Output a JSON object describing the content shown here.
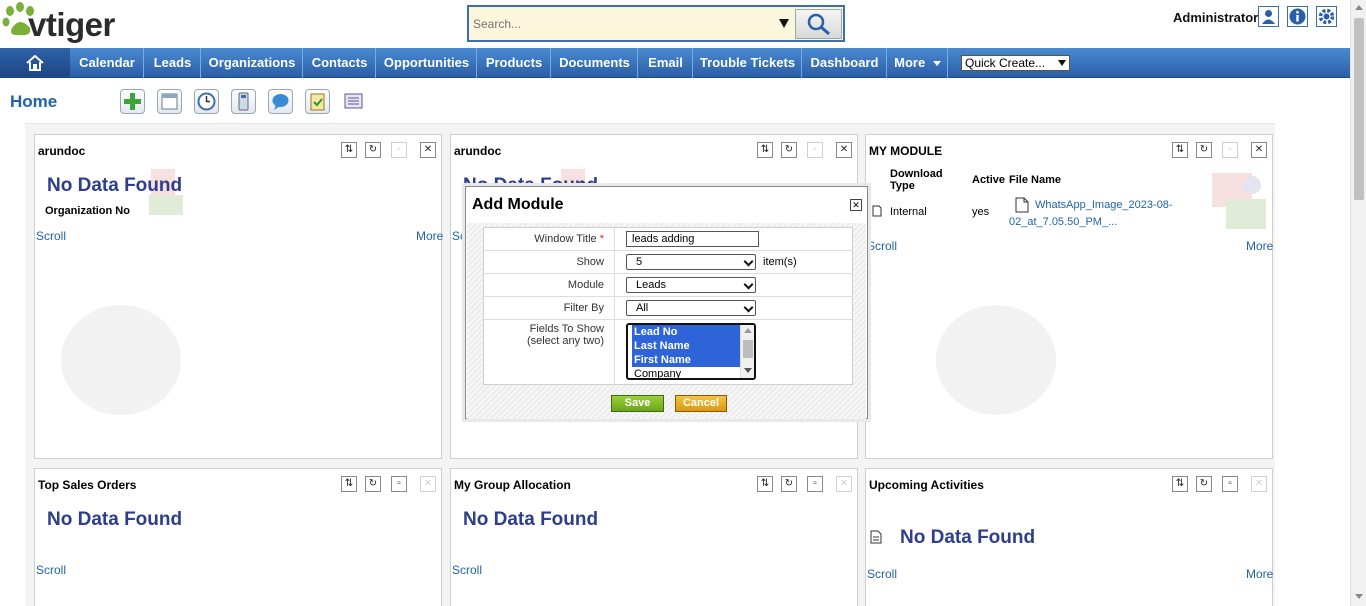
{
  "app": {
    "logo_text": "vtiger",
    "user": "Administrator"
  },
  "search": {
    "placeholder": "Search..."
  },
  "nav": {
    "items": [
      "Calendar",
      "Leads",
      "Organizations",
      "Contacts",
      "Opportunities",
      "Products",
      "Documents",
      "Email",
      "Trouble Tickets",
      "Dashboard",
      "More"
    ],
    "quick_create": "Quick Create..."
  },
  "page": {
    "title": "Home"
  },
  "widgets": {
    "w1": {
      "title": "arundoc",
      "nodata": "No Data Found",
      "column": "Organization No",
      "scroll": "Scroll",
      "more": "More"
    },
    "w2": {
      "title": "arundoc",
      "nodata": "No Data Found",
      "scroll": "Scroll"
    },
    "w3": {
      "title": "MY MODULE",
      "col_download_type": "Download Type",
      "col_active": "Active",
      "col_file_name": "File Name",
      "row_type": "Internal",
      "row_active": "yes",
      "row_file_line1": "WhatsApp_Image_2023-08-",
      "row_file_line2": "02_at_7.05.50_PM_...",
      "scroll": "Scroll",
      "more": "More"
    },
    "w4": {
      "title": "Top Sales Orders",
      "nodata": "No Data Found",
      "scroll": "Scroll"
    },
    "w5": {
      "title": "My Group Allocation",
      "nodata": "No Data Found",
      "scroll": "Scroll"
    },
    "w6": {
      "title": "Upcoming Activities",
      "nodata": "No Data Found",
      "scroll": "Scroll",
      "more": "More"
    }
  },
  "modal": {
    "title": "Add Module",
    "window_title_label": "Window Title",
    "required_mark": "*",
    "window_title_value": "leads adding",
    "show_label": "Show",
    "show_value": "5",
    "show_suffix": "item(s)",
    "module_label": "Module",
    "module_value": "Leads",
    "filter_label": "Filter By",
    "filter_value": "All",
    "fields_label_1": "Fields To Show",
    "fields_label_2": "(select any two)",
    "fields": [
      {
        "label": "Lead No",
        "selected": true
      },
      {
        "label": "Last Name",
        "selected": true
      },
      {
        "label": "First Name",
        "selected": true
      },
      {
        "label": "Company",
        "selected": false
      }
    ],
    "save": "Save",
    "cancel": "Cancel"
  },
  "colors": {
    "nav": "#3a78c0",
    "accent": "#1f63a8",
    "nodata": "#2c3e8c",
    "save": "#7fbf27",
    "cancel": "#e6ad1f"
  },
  "icons": [
    "home-icon",
    "search-icon",
    "user-icon",
    "info-icon",
    "settings-icon",
    "add-icon",
    "calendar-icon",
    "clock-icon",
    "calculator-icon",
    "chat-icon",
    "clipboard-icon",
    "notes-icon"
  ]
}
